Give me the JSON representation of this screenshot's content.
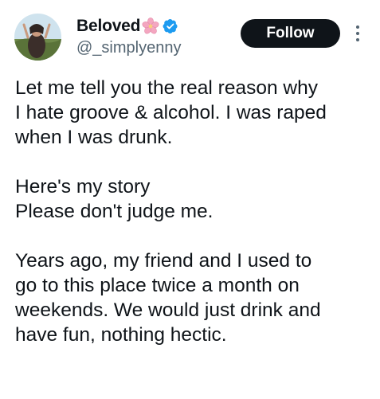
{
  "user": {
    "display_name": "Beloved",
    "handle": "@_simplyenny",
    "verified": true,
    "name_emoji": "cherry-blossom-icon"
  },
  "actions": {
    "follow_label": "Follow",
    "more_icon": "more-vertical-icon"
  },
  "tweet": {
    "paragraphs": [
      {
        "lines": [
          "Let me tell you the real reason why",
          "I hate groove & alcohol. I was raped",
          "when I was drunk."
        ]
      },
      {
        "lines": [
          "Here's my story",
          "Please don't judge me."
        ]
      },
      {
        "lines": [
          "Years ago, my friend and I used to",
          "go to this place twice a month on",
          "weekends. We would just drink and",
          "have fun, nothing hectic."
        ]
      }
    ]
  },
  "colors": {
    "text": "#0f1419",
    "secondary_text": "#536471",
    "verified_blue": "#1d9bf0",
    "follow_bg": "#0f1419",
    "follow_text": "#ffffff",
    "flower_pink": "#f4a6c0"
  }
}
